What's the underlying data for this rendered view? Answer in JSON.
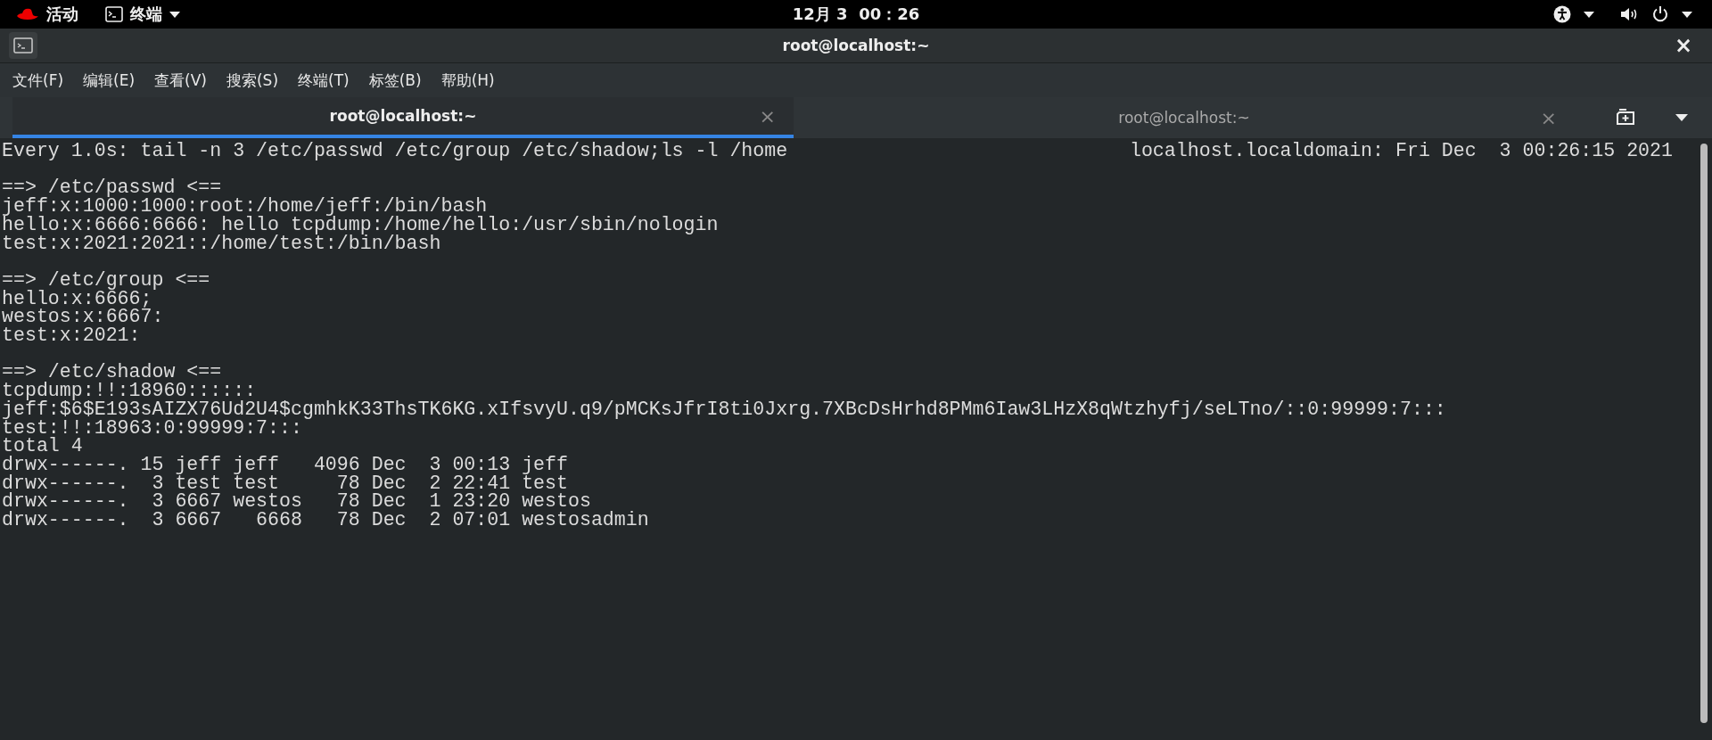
{
  "top_bar": {
    "activities": "活动",
    "app_menu": "终端",
    "clock": "12月 3  00：26"
  },
  "window": {
    "title": "root@localhost:~",
    "close": "×"
  },
  "menu": [
    "文件(F)",
    "编辑(E)",
    "查看(V)",
    "搜索(S)",
    "终端(T)",
    "标签(B)",
    "帮助(H)"
  ],
  "tabs": [
    {
      "label": "root@localhost:~",
      "close": "×",
      "selected": true
    },
    {
      "label": "root@localhost:~",
      "close": "×",
      "selected": false
    }
  ],
  "terminal": {
    "command": "Every 1.0s: tail -n 3 /etc/passwd /etc/group /etc/shadow;ls -l /home",
    "host_time": "localhost.localdomain: Fri Dec  3 00:26:15 2021",
    "blocks": [
      {
        "lines": [
          "==> /etc/passwd <==",
          "jeff:x:1000:1000:root:/home/jeff:/bin/bash",
          "hello:x:6666:6666: hello tcpdump:/home/hello:/usr/sbin/nologin",
          "test:x:2021:2021::/home/test:/bin/bash"
        ]
      },
      {
        "lines": [
          "==> /etc/group <==",
          "hello:x:6666;",
          "westos:x:6667:",
          "test:x:2021:"
        ]
      },
      {
        "lines": [
          "==> /etc/shadow <==",
          "tcpdump:!!:18960::::::",
          "jeff:$6$E193sAIZX76Ud2U4$cgmhkK33ThsTK6KG.xIfsvyU.q9/pMCKsJfrI8ti0Jxrg.7XBcDsHrhd8PMm6Iaw3LHzX8qWtzhyfj/seLTno/::0:99999:7:::",
          "test:!!:18963:0:99999:7:::",
          "total 4",
          "drwx------. 15 jeff jeff   4096 Dec  3 00:13 jeff",
          "drwx------.  3 test test     78 Dec  2 22:41 test",
          "drwx------.  3 6667 westos   78 Dec  1 23:20 westos",
          "drwx------.  3 6667   6668   78 Dec  2 07:01 westosadmin"
        ]
      }
    ]
  }
}
